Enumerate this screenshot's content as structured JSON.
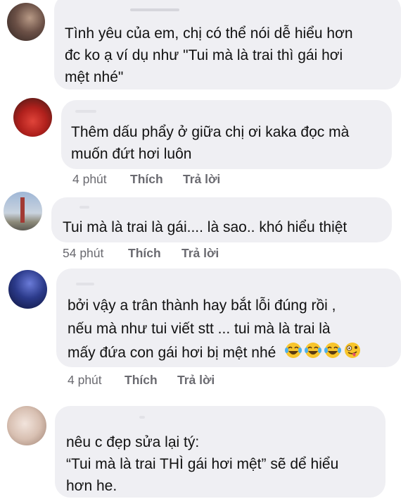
{
  "comments": [
    {
      "lines": [
        "Tình yêu của em, chị có thể nói dễ hiểu hơn",
        "đc ko ạ ví dụ như \"Tui mà là trai thì gái hơi",
        "mệt nhé\""
      ],
      "avatar_icon": "user-photo-avatar"
    },
    {
      "lines": [
        "Thêm dấu phẩy ở giữa chị ơi kaka đọc mà",
        "muốn đứt hơi luôn"
      ],
      "time": "4 phút",
      "like": "Thích",
      "reply": "Trả lời",
      "avatar_icon": "user-photo-avatar"
    },
    {
      "lines": [
        "Tui mà là trai là gái.... là sao.. khó hiểu thiệt"
      ],
      "time": "54 phút",
      "like": "Thích",
      "reply": "Trả lời",
      "avatar_icon": "user-photo-avatar"
    },
    {
      "lines": [
        "bởi vậy a trân thành hay bắt lỗi đúng rồi ,",
        "nếu mà như tui viết stt ... tui mà là trai là",
        "mấy đứa con gái hơi bị mệt nhé"
      ],
      "emojis": [
        "laughing-tears-emoji",
        "laughing-tears-emoji",
        "laughing-tears-emoji",
        "zany-face-emoji"
      ],
      "time": "4 phút",
      "like": "Thích",
      "reply": "Trả lời",
      "avatar_icon": "user-photo-avatar"
    },
    {
      "lines": [
        "nêu c đẹp sửa lại tý:",
        "“Tui mà là trai THÌ gái hơi mệt” sẽ dể hiểu",
        "hơn he."
      ],
      "avatar_icon": "user-photo-avatar"
    }
  ],
  "colors": {
    "bubble": "#efeff3",
    "meta_text": "#6a6a70",
    "text": "#111111"
  }
}
